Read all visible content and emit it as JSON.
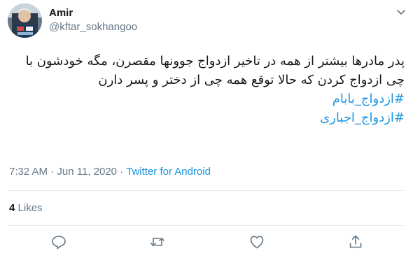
{
  "author": {
    "display_name": "Amir",
    "handle": "@kftar_sokhangoo",
    "avatar_icon": "profile-photo"
  },
  "tweet": {
    "text": "پدر مادرها بیشتر از همه در تاخیر ازدواج جوونها مقصرن، مگه خودشون با چی ازدواج کردن که حالا توقع همه چی از دختر و پسر دارن",
    "hashtags": [
      "#ازدواج_بابام",
      "#ازدواج_اجباری"
    ],
    "time": "7:32 AM",
    "separator": "·",
    "date": "Jun 11, 2020",
    "source": "Twitter for Android"
  },
  "stats": {
    "likes_count": "4",
    "likes_label": "Likes"
  },
  "actions": {
    "reply_icon": "reply-icon",
    "retweet_icon": "retweet-icon",
    "like_icon": "heart-icon",
    "share_icon": "share-icon",
    "more_icon": "chevron-down-icon"
  },
  "colors": {
    "link": "#1b95e0",
    "secondary_text": "#657786",
    "primary_text": "#14171a",
    "divider": "#e6ecf0"
  }
}
